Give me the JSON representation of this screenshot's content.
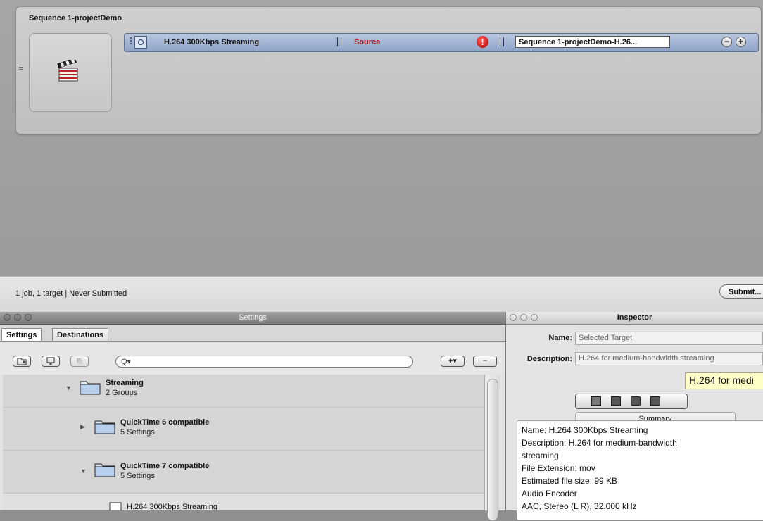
{
  "batch": {
    "title": "Sequence 1-projectDemo",
    "target": {
      "setting_name": "H.264 300Kbps Streaming",
      "source_label": "Source",
      "warning_glyph": "!",
      "destination_file": "Sequence 1-projectDemo-H.26...",
      "remove_glyph": "−",
      "add_glyph": "+"
    }
  },
  "status": {
    "text": "1 job, 1 target  |  Never Submitted",
    "submit_label": "Submit..."
  },
  "settings_window": {
    "title": "Settings",
    "tabs": [
      {
        "label": "Settings"
      },
      {
        "label": "Destinations"
      }
    ],
    "search_placeholder": "Q▾",
    "add_label": "+▾",
    "remove_label": "−",
    "items": [
      {
        "title": "Streaming",
        "subtitle": "2 Groups",
        "expanded": true
      },
      {
        "title": "QuickTime 6 compatible",
        "subtitle": "5 Settings",
        "expanded": false
      },
      {
        "title": "QuickTime 7 compatible",
        "subtitle": "5 Settings",
        "expanded": true
      },
      {
        "title": "H.264 300Kbps Streaming",
        "subtitle": ""
      }
    ]
  },
  "inspector": {
    "title": "Inspector",
    "name_label": "Name:",
    "name_value": "Selected Target",
    "description_label": "Description:",
    "description_value": "H.264 for medium-bandwidth streaming",
    "tooltip": "H.264 for medi",
    "summary_label": "Summary",
    "summary_lines": [
      "Name: H.264 300Kbps Streaming",
      "Description: H.264 for medium-bandwidth",
      "streaming",
      "File Extension: mov",
      "Estimated file size: 99 KB",
      "Audio Encoder",
      "      AAC, Stereo (L R), 32.000 kHz"
    ]
  },
  "colors": {
    "selected_row": "#9aaed0",
    "source_text": "#a1121a",
    "warning": "#c40000",
    "tooltip_bg": "#fffec8"
  }
}
